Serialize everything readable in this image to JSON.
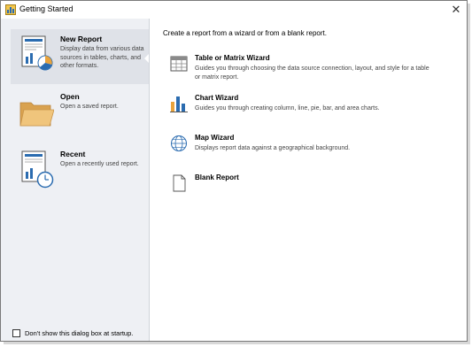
{
  "window": {
    "title": "Getting Started",
    "close_glyph": "✕"
  },
  "sidebar": {
    "items": [
      {
        "title": "New Report",
        "description": "Display data from various data sources in tables, charts, and other formats.",
        "icon": "new-report-icon",
        "selected": true
      },
      {
        "title": "Open",
        "description": "Open a saved report.",
        "icon": "folder-icon",
        "selected": false
      },
      {
        "title": "Recent",
        "description": "Open a recently used report.",
        "icon": "recent-report-icon",
        "selected": false
      }
    ],
    "footer": {
      "checkbox_label": "Don't show this dialog box at startup.",
      "checked": false
    }
  },
  "main": {
    "intro": "Create a report from a wizard or from a blank report.",
    "wizards": [
      {
        "title": "Table or Matrix Wizard",
        "description": "Guides you through choosing the data source connection, layout, and style for a table or matrix report.",
        "icon": "table-icon"
      },
      {
        "title": "Chart Wizard",
        "description": "Guides you through creating column, line, pie, bar, and area charts.",
        "icon": "chart-icon"
      },
      {
        "title": "Map Wizard",
        "description": "Displays report data against a geographical background.",
        "icon": "globe-icon"
      },
      {
        "title": "Blank Report",
        "description": "",
        "icon": "blank-page-icon"
      }
    ]
  },
  "colors": {
    "sidebar_bg": "#eef0f4",
    "selected_bg": "#dfe2e8",
    "accent_blue": "#2b6cb0",
    "folder": "#e8b96a",
    "chart_orange": "#e8a33d"
  }
}
